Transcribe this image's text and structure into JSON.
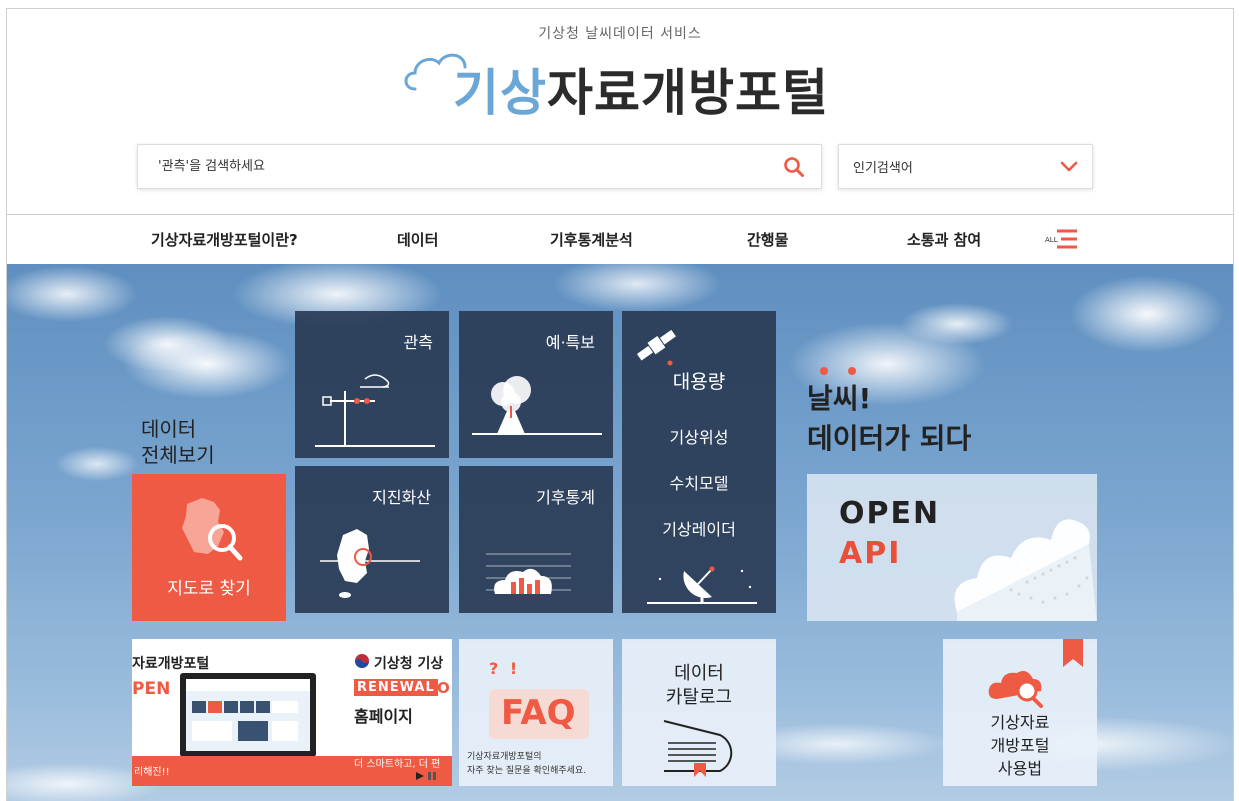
{
  "header": {
    "subtitle": "기상청 날씨데이터 서비스",
    "logo_blue": "기상",
    "logo_dark": "자료개방포털"
  },
  "search": {
    "placeholder": "'관측'을 검색하세요",
    "popular_label": "인기검색어"
  },
  "nav": {
    "items": [
      "기상자료개방포털이란?",
      "데이터",
      "기후통계분석",
      "간행물",
      "소통과 참여"
    ],
    "all_label": "ALL"
  },
  "hero": {
    "all_data_line1": "데이터",
    "all_data_line2": "전체보기",
    "map_search": "지도로 찾기",
    "tiles": {
      "observation": "관측",
      "forecast": "예·특보",
      "earthquake": "지진화산",
      "climate_stats": "기후통계"
    },
    "large_data": {
      "title": "대용량",
      "items": [
        "기상위성",
        "수치모델",
        "기상레이더"
      ]
    },
    "tagline_line1": "날씨!",
    "tagline_line2": "데이터가 되다",
    "open_api_line1": "OPEN",
    "open_api_line2": "API",
    "banner": {
      "portal_text": "자료개방포털",
      "open_text": "PEN",
      "kma_text": "기상청 기상",
      "renewal": "RENEWAL",
      "renewal_tail": "O",
      "homepage": "홈페이지",
      "left_foot": "리해진!!",
      "right_foot": "더 스마트하고, 더 편"
    },
    "faq": {
      "marks": "? !",
      "title": "FAQ",
      "desc_line1": "기상자료개방포털의",
      "desc_line2": "자주 찾는 질문을 확인해주세요."
    },
    "catalog": {
      "line1": "데이터",
      "line2": "카탈로그"
    },
    "guide": {
      "line1": "기상자료",
      "line2": "개방포털",
      "line3": "사용법"
    }
  },
  "colors": {
    "accent": "#ee5a43",
    "logo_blue": "#6aa6d6",
    "tile_dark": "#283852"
  }
}
